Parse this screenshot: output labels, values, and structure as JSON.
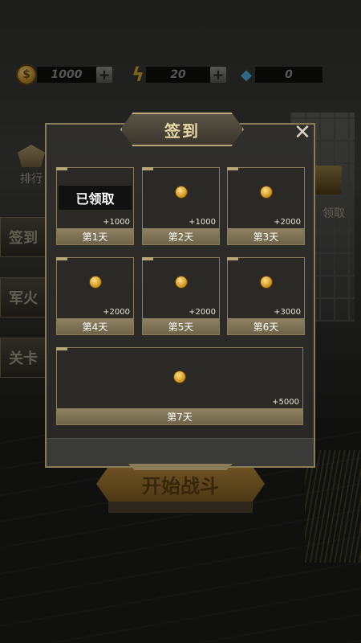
{
  "resources": {
    "coins": "1000",
    "energy": "20",
    "diamonds": "0"
  },
  "icons": {
    "coin": "coin-icon",
    "plus": "plus-icon",
    "energy": "lightning-icon",
    "diamond": "diamond-icon",
    "close": "close-icon"
  },
  "side_menu": {
    "rank_label": "排行",
    "signin_label": "签到",
    "arsenal_label": "军火",
    "level_label": "关卡",
    "chest_label": "领取"
  },
  "start_battle_label": "开始战斗",
  "dialog": {
    "title": "签到",
    "close_glyph": "✕",
    "claimed_label": "已领取",
    "days": [
      {
        "label": "第1天",
        "amount": "+1000",
        "claimed": true
      },
      {
        "label": "第2天",
        "amount": "+1000",
        "claimed": false
      },
      {
        "label": "第3天",
        "amount": "+2000",
        "claimed": false
      },
      {
        "label": "第4天",
        "amount": "+2000",
        "claimed": false
      },
      {
        "label": "第5天",
        "amount": "+2000",
        "claimed": false
      },
      {
        "label": "第6天",
        "amount": "+3000",
        "claimed": false
      },
      {
        "label": "第7天",
        "amount": "+5000",
        "claimed": false
      }
    ]
  },
  "colors": {
    "frame_gold": "#8a7c58",
    "coin_gold": "#d39a26",
    "footer_tan": "#8f8262"
  }
}
